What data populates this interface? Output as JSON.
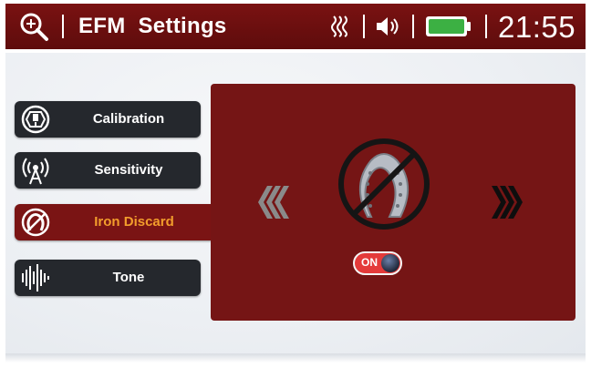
{
  "header": {
    "title": "EFM  Settings",
    "time": "21:55",
    "search_icon": "search-zoom-icon",
    "status_icons": [
      "heat-waves-icon",
      "speaker-icon",
      "battery-icon"
    ],
    "battery_color": "#3cb043"
  },
  "menu": {
    "items": [
      {
        "label": "Calibration",
        "icon": "calibration-icon",
        "active": false
      },
      {
        "label": "Sensitivity",
        "icon": "antenna-icon",
        "active": false
      },
      {
        "label": "Iron Discard",
        "icon": "iron-discard-icon",
        "active": true
      },
      {
        "label": "Tone",
        "icon": "sound-wave-icon",
        "active": false
      }
    ]
  },
  "panel": {
    "feature_icon": "horseshoe-prohibited-icon",
    "toggle_label": "ON",
    "toggle_state": true
  },
  "colors": {
    "header_bg": "#6b1010",
    "panel_bg": "#751515",
    "menu_bg": "#25282d",
    "active_text": "#f29d2c",
    "toggle_on": "#e43a3a"
  }
}
